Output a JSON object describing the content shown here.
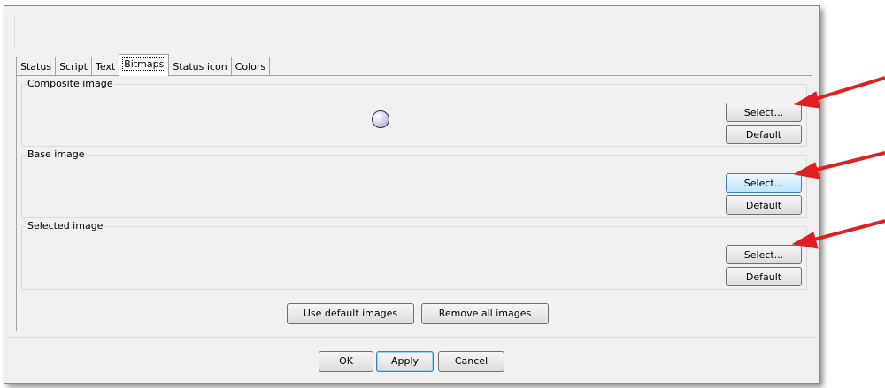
{
  "tabs": [
    {
      "label": "Status"
    },
    {
      "label": "Script"
    },
    {
      "label": "Text"
    },
    {
      "label": "Bitmaps",
      "active": true
    },
    {
      "label": "Status icon"
    },
    {
      "label": "Colors"
    }
  ],
  "groups": {
    "composite": {
      "title": "Composite image",
      "select": "Select...",
      "default": "Default"
    },
    "base": {
      "title": "Base image",
      "select": "Select...",
      "default": "Default"
    },
    "selected": {
      "title": "Selected image",
      "select": "Select...",
      "default": "Default"
    }
  },
  "actions": {
    "use_default": "Use default images",
    "remove_all": "Remove all images"
  },
  "dialog_buttons": {
    "ok": "OK",
    "apply": "Apply",
    "cancel": "Cancel"
  },
  "annotation_color": "#e02020"
}
